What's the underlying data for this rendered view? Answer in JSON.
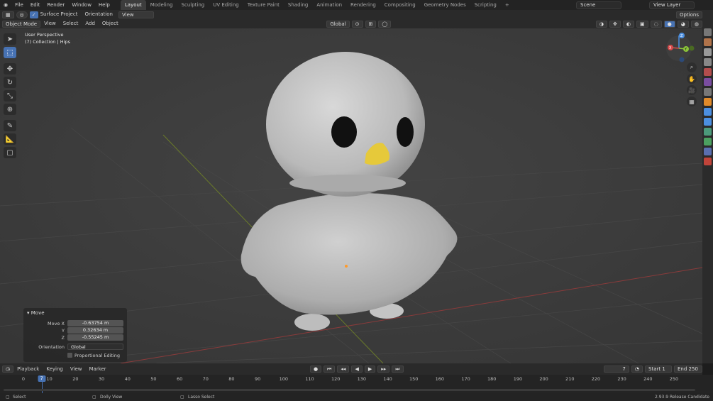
{
  "menu": [
    "File",
    "Edit",
    "Render",
    "Window",
    "Help"
  ],
  "workspaces": [
    "Layout",
    "Modeling",
    "Sculpting",
    "UV Editing",
    "Texture Paint",
    "Shading",
    "Animation",
    "Rendering",
    "Compositing",
    "Geometry Nodes",
    "Scripting"
  ],
  "active_workspace": "Layout",
  "scene": "Scene",
  "view_layer": "View Layer",
  "tool_header": {
    "surface_project": "Surface Project",
    "orientation_label": "Orientation",
    "orientation_value": "View",
    "options": "Options"
  },
  "viewport_header": {
    "mode": "Object Mode",
    "items": [
      "View",
      "Select",
      "Add",
      "Object"
    ],
    "transform_orientation": "Global"
  },
  "overlay": {
    "perspective": "User Perspective",
    "collection": "(7) Collection | Hips"
  },
  "gizmo": {
    "x": "X",
    "y": "Y",
    "z": "Z"
  },
  "move_panel": {
    "title": "Move",
    "move_x_label": "Move X",
    "y_label": "Y",
    "z_label": "Z",
    "move_x": "-0.63754 m",
    "y": "0.32634 m",
    "z": "-0.55245 m",
    "orientation_label": "Orientation",
    "orientation": "Global",
    "proportional": "Proportional Editing"
  },
  "timeline_header": {
    "items": [
      "Playback",
      "Keying",
      "View",
      "Marker"
    ],
    "current_frame": "7",
    "start_label": "Start",
    "start": "1",
    "end_label": "End",
    "end": "250"
  },
  "timeline_ticks": [
    "0",
    "10",
    "20",
    "30",
    "40",
    "50",
    "60",
    "70",
    "80",
    "90",
    "100",
    "110",
    "120",
    "130",
    "140",
    "150",
    "160",
    "170",
    "180",
    "190",
    "200",
    "210",
    "220",
    "230",
    "240",
    "250"
  ],
  "playhead": "7",
  "status": {
    "left": "Select",
    "middle": "Dolly View",
    "right_hint": "Lasso Select",
    "version": "2.93.9 Release Candidate"
  },
  "colors": {
    "accent": "#4772b3",
    "beak": "#e6c93a",
    "body": "#c9c9c9"
  }
}
